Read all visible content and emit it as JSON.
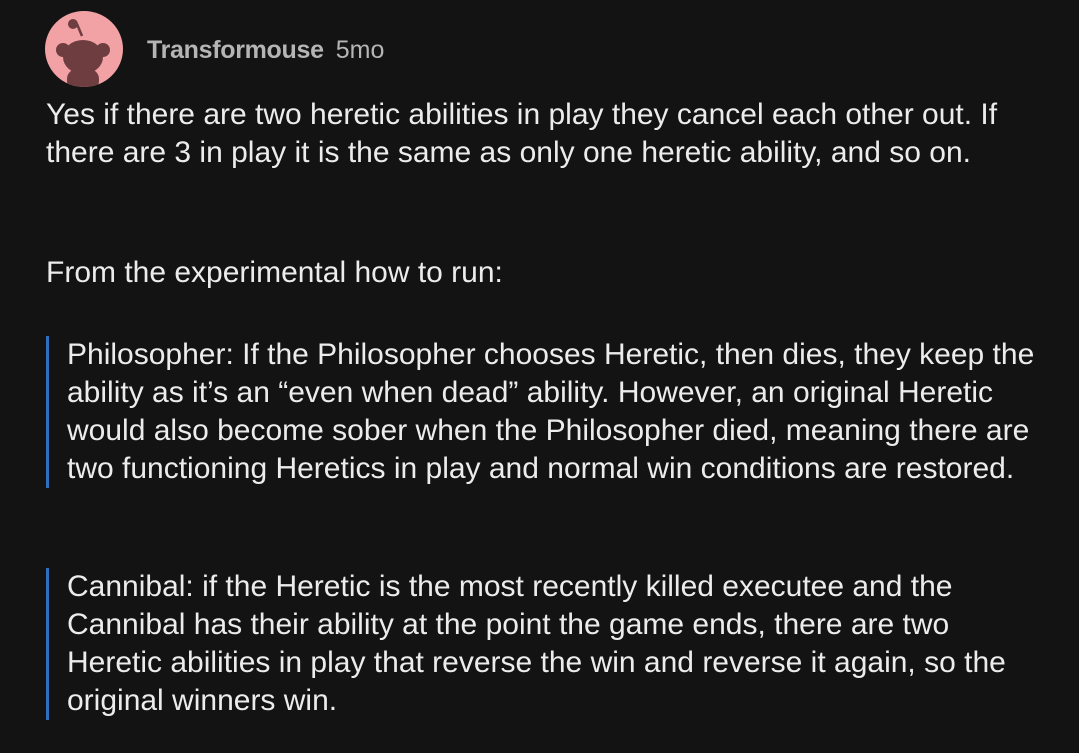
{
  "comment": {
    "author": "Transformouse",
    "age": "5mo",
    "avatar_icon": "reddit-snoo-avatar-icon",
    "avatar_color": "#f2a2a4",
    "paragraphs": [
      "Yes if there are two heretic abilities in play they cancel each other out. If there are 3 in play it is the same as only one heretic ability, and so on.",
      "From the experimental how to run:"
    ],
    "quotes": [
      "Philosopher: If the Philosopher chooses Heretic, then dies, they keep the ability as it’s an “even when dead” ability. However, an original Heretic would also become sober when the Philosopher died, meaning there are two functioning Heretics in play and normal win conditions are restored.",
      "Cannibal: if the Heretic is the most recently killed executee and the Cannibal has their ability at the point the game ends, there are two Heretic abilities in play that reverse the win and reverse it again, so the original winners win."
    ],
    "quote_bar_color": "#2f6fbd"
  }
}
